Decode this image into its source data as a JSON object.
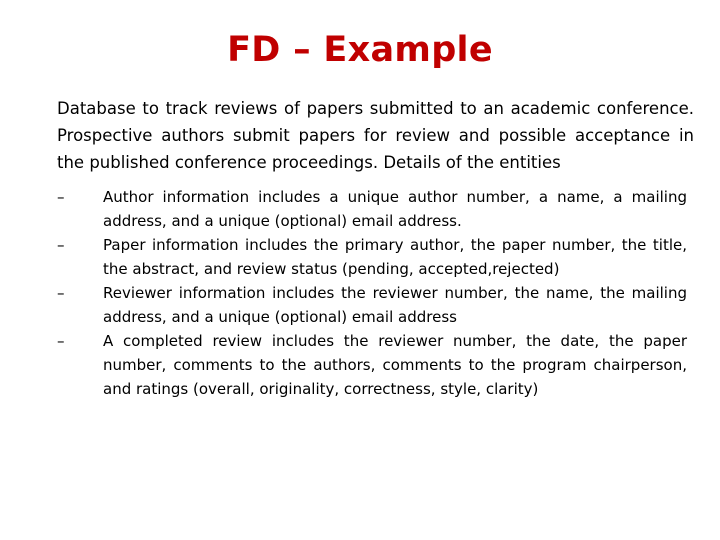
{
  "slide": {
    "title": "FD – Example",
    "title_color": "#c00000",
    "background_color": "#ffffff",
    "text_color": "#000000",
    "intro_paragraph": "Database to track reviews of papers submitted to an academic conference. Prospective authors submit papers for review and possible acceptance in the published conference proceedings. Details of the entities",
    "bullet_marker": "–",
    "bullets": [
      {
        "marker": "–",
        "text": "Author information includes a unique author number, a name, a mailing address, and a unique (optional) email address."
      },
      {
        "marker": "–",
        "text": "Paper information includes the primary author, the paper number, the title, the abstract, and review status (pending, accepted,rejected)"
      },
      {
        "marker": "–",
        "text": "Reviewer information includes the reviewer number, the name, the mailing address, and a unique (optional) email address"
      },
      {
        "marker": "–",
        "text": "A completed review includes the reviewer number, the date, the paper number, comments to the authors, comments to the program chairperson, and ratings (overall, originality, correctness, style, clarity)"
      }
    ]
  }
}
